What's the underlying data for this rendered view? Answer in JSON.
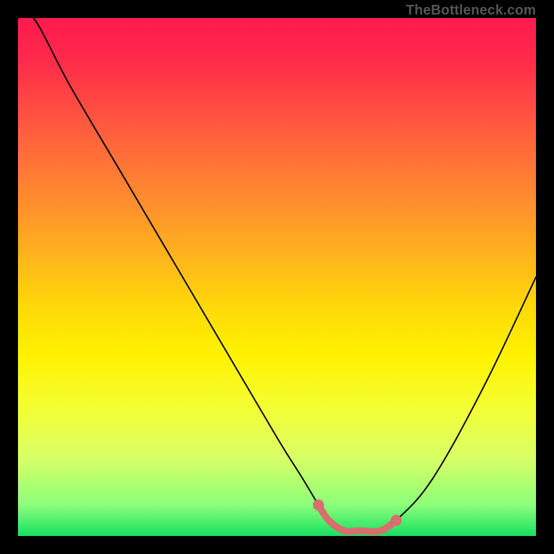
{
  "attribution": "TheBottleneck.com",
  "colors": {
    "background": "#000000",
    "gradient_top": "#ff1a4f",
    "gradient_bottom": "#18e060",
    "curve": "#000000",
    "marker": "#d86f6e"
  },
  "chart_data": {
    "type": "line",
    "title": "",
    "xlabel": "",
    "ylabel": "",
    "xlim": [
      0,
      100
    ],
    "ylim": [
      0,
      100
    ],
    "x": [
      0,
      3,
      10,
      20,
      30,
      40,
      50,
      55,
      58,
      60,
      63,
      66,
      70,
      73,
      80,
      90,
      100
    ],
    "values": [
      100,
      100,
      87,
      70,
      53,
      36,
      19,
      11,
      6,
      3,
      1,
      1,
      1,
      3,
      11,
      29,
      50
    ],
    "annotations": {
      "highlight_segment": {
        "x": [
          58,
          60,
          63,
          66,
          70,
          73
        ],
        "values": [
          6,
          3,
          1,
          1,
          1,
          3
        ],
        "style": "thick-stroke",
        "markers_at_ends": true
      }
    }
  }
}
